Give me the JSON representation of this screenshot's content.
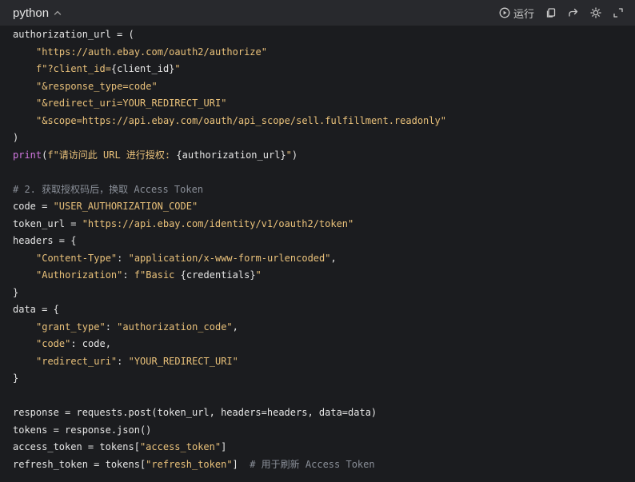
{
  "header": {
    "language": "python",
    "run_label": "运行",
    "icons": [
      "chevron-up-icon",
      "play-circle-icon",
      "copy-icon",
      "share-icon",
      "theme-icon",
      "expand-icon"
    ]
  },
  "code": [
    [
      {
        "t": "authorization_url = (",
        "c": ""
      }
    ],
    [
      {
        "t": "\"https://auth.ebay.com/oauth2/authorize\"",
        "c": "str"
      }
    ],
    [
      {
        "t": "f\"?client_id=",
        "c": "str"
      },
      {
        "t": "{client_id}",
        "c": ""
      },
      {
        "t": "\"",
        "c": "str"
      }
    ],
    [
      {
        "t": "\"&response_type=code\"",
        "c": "str"
      }
    ],
    [
      {
        "t": "\"&redirect_uri=YOUR_REDIRECT_URI\"",
        "c": "str"
      }
    ],
    [
      {
        "t": "\"&scope=https://api.ebay.com/oauth/api_scope/sell.fulfillment.readonly\"",
        "c": "str"
      }
    ],
    [
      {
        "t": ")",
        "c": ""
      }
    ],
    [
      {
        "t": "print",
        "c": "fn"
      },
      {
        "t": "(",
        "c": ""
      },
      {
        "t": "f\"请访问此 URL 进行授权: ",
        "c": "str"
      },
      {
        "t": "{authorization_url}",
        "c": ""
      },
      {
        "t": "\"",
        "c": "str"
      },
      {
        "t": ")",
        "c": ""
      }
    ],
    [],
    [
      {
        "t": "# 2. 获取授权码后，换取 Access Token",
        "c": "cm"
      }
    ],
    [
      {
        "t": "code = ",
        "c": ""
      },
      {
        "t": "\"USER_AUTHORIZATION_CODE\"",
        "c": "str"
      }
    ],
    [
      {
        "t": "token_url = ",
        "c": ""
      },
      {
        "t": "\"https://api.ebay.com/identity/v1/oauth2/token\"",
        "c": "str"
      }
    ],
    [
      {
        "t": "headers = {",
        "c": ""
      }
    ],
    [
      {
        "t": "\"Content-Type\"",
        "c": "str"
      },
      {
        "t": ": ",
        "c": ""
      },
      {
        "t": "\"application/x-www-form-urlencoded\"",
        "c": "str"
      },
      {
        "t": ",",
        "c": ""
      }
    ],
    [
      {
        "t": "\"Authorization\"",
        "c": "str"
      },
      {
        "t": ": ",
        "c": ""
      },
      {
        "t": "f\"Basic ",
        "c": "str"
      },
      {
        "t": "{credentials}",
        "c": ""
      },
      {
        "t": "\"",
        "c": "str"
      }
    ],
    [
      {
        "t": "}",
        "c": ""
      }
    ],
    [
      {
        "t": "data = {",
        "c": ""
      }
    ],
    [
      {
        "t": "\"grant_type\"",
        "c": "str"
      },
      {
        "t": ": ",
        "c": ""
      },
      {
        "t": "\"authorization_code\"",
        "c": "str"
      },
      {
        "t": ",",
        "c": ""
      }
    ],
    [
      {
        "t": "\"code\"",
        "c": "str"
      },
      {
        "t": ": code,",
        "c": ""
      }
    ],
    [
      {
        "t": "\"redirect_uri\"",
        "c": "str"
      },
      {
        "t": ": ",
        "c": ""
      },
      {
        "t": "\"YOUR_REDIRECT_URI\"",
        "c": "str"
      }
    ],
    [
      {
        "t": "}",
        "c": ""
      }
    ],
    [],
    [
      {
        "t": "response = requests.post(token_url, headers=headers, data=data)",
        "c": ""
      }
    ],
    [
      {
        "t": "tokens = response.json()",
        "c": ""
      }
    ],
    [
      {
        "t": "access_token = tokens[",
        "c": ""
      },
      {
        "t": "\"access_token\"",
        "c": "str"
      },
      {
        "t": "]",
        "c": ""
      }
    ],
    [
      {
        "t": "refresh_token = tokens[",
        "c": ""
      },
      {
        "t": "\"refresh_token\"",
        "c": "str"
      },
      {
        "t": "]  ",
        "c": ""
      },
      {
        "t": "# 用于刷新 Access Token",
        "c": "cm"
      }
    ]
  ]
}
